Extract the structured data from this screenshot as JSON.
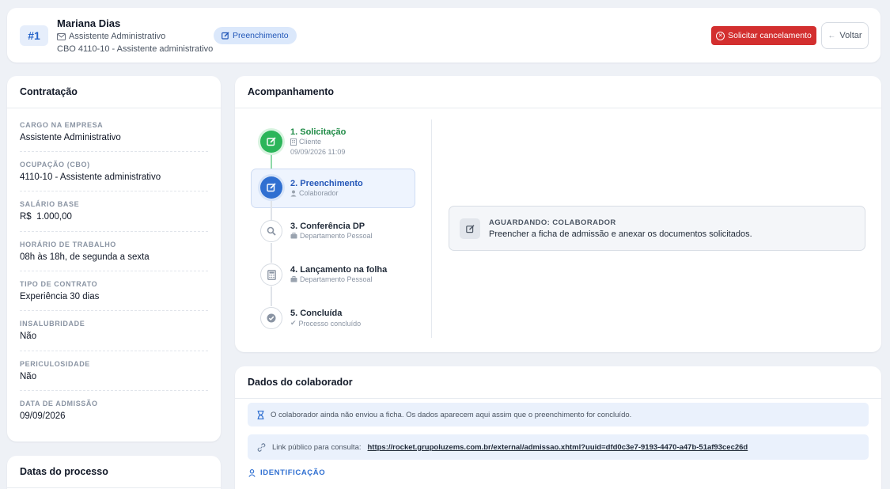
{
  "header": {
    "id_label": "#1",
    "name": "Mariana Dias",
    "role": "Assistente Administrativo",
    "cbo": "CBO 4110-10 - Assistente administrativo",
    "status_pill": "Preenchimento",
    "cancel_label": "Solicitar cancelamento",
    "back_label": "Voltar",
    "colors": {
      "primary": "#2f6fd1",
      "danger": "#d32f2f",
      "success": "#2bb55a"
    }
  },
  "contratacao": {
    "title": "Contratação",
    "fields": [
      {
        "label": "Cargo na empresa",
        "value": "Assistente Administrativo"
      },
      {
        "label": "Ocupação (CBO)",
        "value": "4110-10 - Assistente administrativo"
      },
      {
        "label": "Salário base",
        "value": "R$  1.000,00"
      },
      {
        "label": "Horário de trabalho",
        "value": "08h às 18h, de segunda a sexta"
      },
      {
        "label": "Tipo de contrato",
        "value": "Experiência 30 dias"
      },
      {
        "label": "Insalubridade",
        "value": "Não"
      },
      {
        "label": "Periculosidade",
        "value": "Não"
      },
      {
        "label": "Data de admissão",
        "value": "09/09/2026"
      }
    ]
  },
  "datas": {
    "title": "Datas do processo"
  },
  "acompanhamento": {
    "title": "Acompanhamento",
    "steps": [
      {
        "title": "1. Solicitação",
        "sub": "Cliente",
        "date": "09/09/2026 11:09",
        "state": "done",
        "icon": "edit-icon"
      },
      {
        "title": "2. Preenchimento",
        "sub": "Colaborador",
        "state": "current",
        "icon": "edit-icon"
      },
      {
        "title": "3. Conferência DP",
        "sub": "Departamento Pessoal",
        "state": "pending",
        "icon": "search-icon"
      },
      {
        "title": "4. Lançamento na folha",
        "sub": "Departamento Pessoal",
        "state": "pending",
        "icon": "calculator-icon"
      },
      {
        "title": "5. Concluída",
        "sub": "Processo concluído",
        "state": "pending",
        "icon": "check-circle-icon"
      }
    ],
    "awaiting": {
      "title": "AGUARDANDO: COLABORADOR",
      "text": "Preencher a ficha de admissão e anexar os documentos solicitados."
    }
  },
  "dados": {
    "title": "Dados do colaborador",
    "notice": "O colaborador ainda não enviou a ficha. Os dados aparecem aqui assim que o preenchimento for concluído.",
    "link_label": "Link público para consulta:",
    "link_url": "https://rocket.grupoluzems.com.br/external/admissao.xhtml?uuid=dfd0c3e7-9193-4470-a47b-51af93cec26d",
    "section": "IDENTIFICAÇÃO"
  }
}
